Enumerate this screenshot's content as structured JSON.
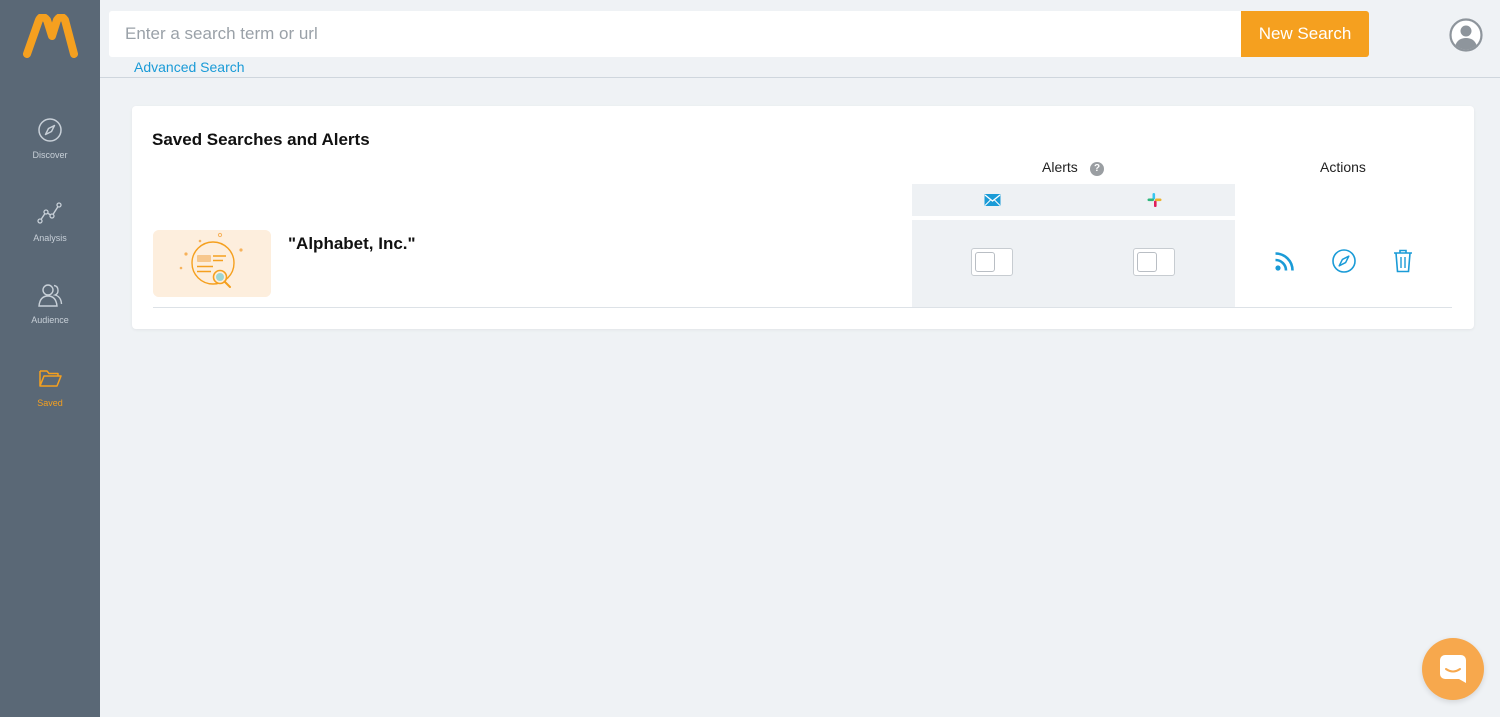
{
  "app": {
    "brand": "M",
    "accent_color": "#f5a01f",
    "link_color": "#1a9bd7"
  },
  "sidebar": {
    "items": [
      {
        "label": "Discover",
        "icon": "compass-icon",
        "active": false
      },
      {
        "label": "Analysis",
        "icon": "analysis-graph-icon",
        "active": false
      },
      {
        "label": "Audience",
        "icon": "audience-people-icon",
        "active": false
      },
      {
        "label": "Saved",
        "icon": "folder-icon",
        "active": true
      }
    ]
  },
  "topbar": {
    "search_placeholder": "Enter a search term or url",
    "search_value": "",
    "new_search_label": "New Search",
    "advanced_search_label": "Advanced Search",
    "avatar_icon": "user-avatar-icon"
  },
  "saved": {
    "title": "Saved Searches and Alerts",
    "alerts_header": "Alerts",
    "help_label": "?",
    "actions_header": "Actions",
    "channels": [
      {
        "name": "email",
        "icon": "email-icon"
      },
      {
        "name": "slack",
        "icon": "slack-icon"
      }
    ],
    "rows": [
      {
        "title": "\"Alphabet, Inc.\"",
        "email_alert": false,
        "slack_alert": false,
        "actions": [
          "rss-feed-icon",
          "compass-icon",
          "trash-icon"
        ]
      }
    ]
  }
}
